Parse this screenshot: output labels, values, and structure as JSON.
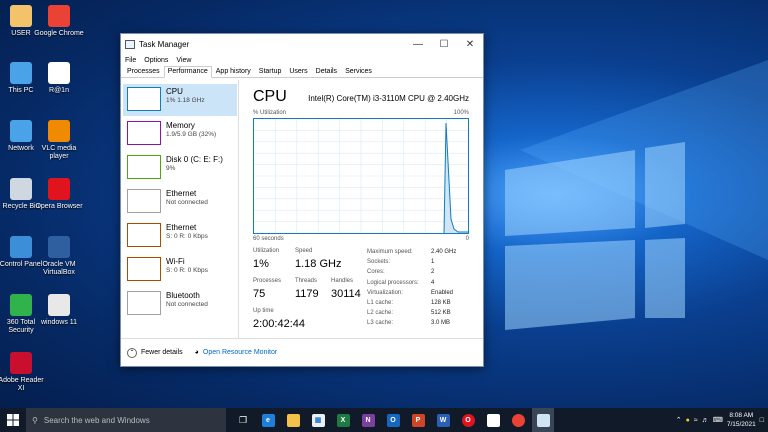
{
  "desktop": {
    "icons": [
      {
        "label": "USER",
        "icon": "user-folder-icon",
        "color": "#f3c26b"
      },
      {
        "label": "Google Chrome",
        "icon": "chrome-icon",
        "color": "#ea4335"
      },
      {
        "label": "This PC",
        "icon": "computer-icon",
        "color": "#4aa3e8"
      },
      {
        "label": "R@1n",
        "icon": "document-icon",
        "color": "#ffffff"
      },
      {
        "label": "Network",
        "icon": "network-icon",
        "color": "#4aa3e8"
      },
      {
        "label": "VLC media player",
        "icon": "vlc-icon",
        "color": "#f08a00"
      },
      {
        "label": "Recycle Bin",
        "icon": "recycle-bin-icon",
        "color": "#cfd8e0"
      },
      {
        "label": "Opera Browser",
        "icon": "opera-icon",
        "color": "#e0141e"
      },
      {
        "label": "Control Panel",
        "icon": "control-panel-icon",
        "color": "#3d8ed8"
      },
      {
        "label": "Oracle VM VirtualBox",
        "icon": "virtualbox-icon",
        "color": "#2f5f9e"
      },
      {
        "label": "360 Total Security",
        "icon": "security-icon",
        "color": "#2fb34a"
      },
      {
        "label": "windows 11",
        "icon": "disc-image-icon",
        "color": "#e8e8e8"
      },
      {
        "label": "Adobe Reader XI",
        "icon": "pdf-icon",
        "color": "#c8102e"
      }
    ]
  },
  "window": {
    "title": "Task Manager",
    "menu": [
      "File",
      "Options",
      "View"
    ],
    "tabs": [
      "Processes",
      "Performance",
      "App history",
      "Startup",
      "Users",
      "Details",
      "Services"
    ],
    "sidebar": [
      {
        "name": "CPU",
        "sub": "1% 1.18 GHz",
        "color": "#117dbb"
      },
      {
        "name": "Memory",
        "sub": "1.9/5.9 GB (32%)",
        "color": "#8b12ae"
      },
      {
        "name": "Disk 0 (C: E: F:)",
        "sub": "9%",
        "color": "#4da60c"
      },
      {
        "name": "Ethernet",
        "sub": "Not connected",
        "color": "#a0a0a0"
      },
      {
        "name": "Ethernet",
        "sub": "S: 0 R: 0 Kbps",
        "color": "#a74f01"
      },
      {
        "name": "Wi-Fi",
        "sub": "S: 0 R: 0 Kbps",
        "color": "#a74f01"
      },
      {
        "name": "Bluetooth",
        "sub": "Not connected",
        "color": "#a0a0a0"
      }
    ],
    "cpu": {
      "heading": "CPU",
      "model": "Intel(R) Core(TM) i3-3110M CPU @ 2.40GHz",
      "graph_label": "% Utilization",
      "graph_max": "100%",
      "graph_time": "60 seconds",
      "graph_min": "0",
      "utilization_label": "Utilization",
      "utilization": "1%",
      "speed_label": "Speed",
      "speed": "1.18 GHz",
      "processes_label": "Processes",
      "processes": "75",
      "threads_label": "Threads",
      "threads": "1179",
      "handles_label": "Handles",
      "handles": "30114",
      "uptime_label": "Up time",
      "uptime": "2:00:42:44",
      "specs_labels": [
        "Maximum speed:",
        "Sockets:",
        "Cores:",
        "Logical processors:",
        "Virtualization:",
        "L1 cache:",
        "L2 cache:",
        "L3 cache:"
      ],
      "specs_values": [
        "2.40 GHz",
        "1",
        "2",
        "4",
        "Enabled",
        "128 KB",
        "512 KB",
        "3.0 MB"
      ]
    },
    "footer": {
      "fewer": "Fewer details",
      "monitor": "Open Resource Monitor"
    }
  },
  "taskbar": {
    "search_placeholder": "Search the web and Windows",
    "time": "8:08 AM",
    "date": "7/15/2021"
  }
}
